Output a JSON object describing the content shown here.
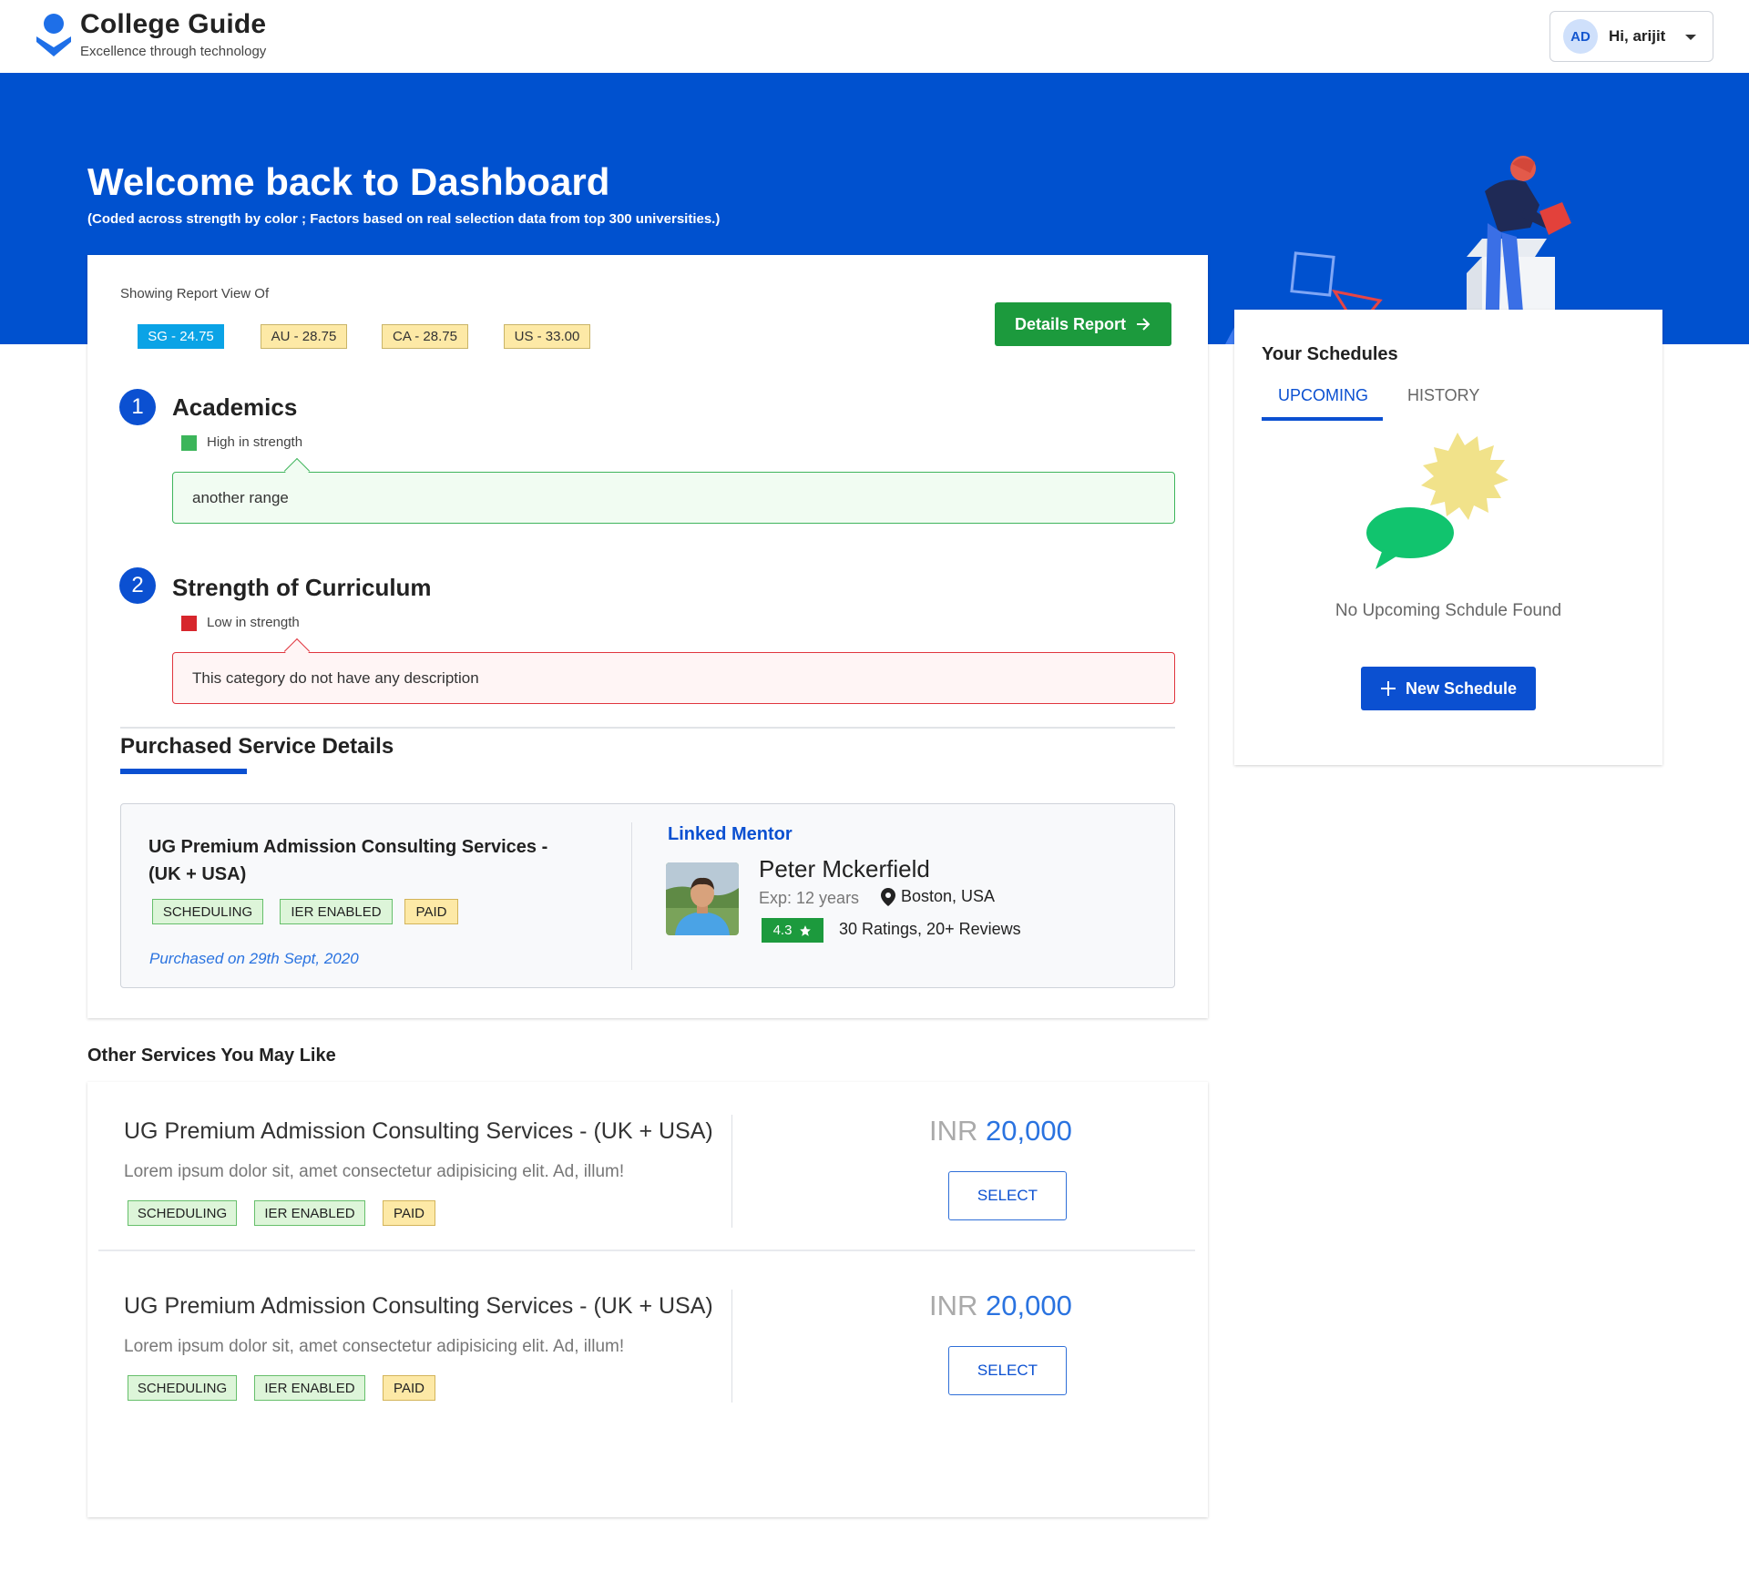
{
  "brand": {
    "title": "College Guide",
    "subtitle": "Excellence through technology"
  },
  "user": {
    "initials": "AD",
    "greeting": "Hi, arijit"
  },
  "hero": {
    "title": "Welcome back to Dashboard",
    "subtitle": "(Coded across strength by color ; Factors based on real selection data from top 300 universities.)"
  },
  "report": {
    "label": "Showing Report View Of",
    "chips": [
      "SG - 24.75",
      "AU - 28.75",
      "CA - 28.75",
      "US - 33.00"
    ],
    "details_button": "Details Report"
  },
  "categories": [
    {
      "number": "1",
      "title": "Academics",
      "strength": "High in strength",
      "strength_color": "#3cb55a",
      "description": "another range"
    },
    {
      "number": "2",
      "title": "Strength of Curriculum",
      "strength": "Low in strength",
      "strength_color": "#d7262c",
      "description": "This category do not have any description"
    }
  ],
  "purchased": {
    "section_title": "Purchased Service Details",
    "service_name": "UG Premium Admission Consulting Services - (UK + USA)",
    "tags": [
      "SCHEDULING",
      "IER ENABLED",
      "PAID"
    ],
    "purchased_on": "Purchased on 29th Sept, 2020",
    "mentor": {
      "label": "Linked Mentor",
      "name": "Peter Mckerfield",
      "experience": "Exp: 12 years",
      "location": "Boston, USA",
      "rating": "4.3",
      "reviews": "30 Ratings, 20+ Reviews"
    }
  },
  "schedules": {
    "title": "Your Schedules",
    "tabs": [
      "UPCOMING",
      "HISTORY"
    ],
    "empty_text": "No Upcoming Schdule Found",
    "new_button": "New Schedule"
  },
  "other_services": {
    "title": "Other Services You May Like",
    "items": [
      {
        "name": "UG Premium Admission Consulting Services - (UK + USA)",
        "description": "Lorem ipsum dolor sit, amet consectetur adipisicing elit. Ad, illum!",
        "tags": [
          "SCHEDULING",
          "IER ENABLED",
          "PAID"
        ],
        "currency": "INR",
        "price": "20,000",
        "button": "SELECT"
      },
      {
        "name": "UG Premium Admission Consulting Services - (UK + USA)",
        "description": "Lorem ipsum dolor sit, amet consectetur adipisicing elit. Ad, illum!",
        "tags": [
          "SCHEDULING",
          "IER ENABLED",
          "PAID"
        ],
        "currency": "INR",
        "price": "20,000",
        "button": "SELECT"
      }
    ]
  },
  "colors": {
    "primary": "#0051cf",
    "success": "#1c9a3d",
    "link": "#2a73e0"
  }
}
